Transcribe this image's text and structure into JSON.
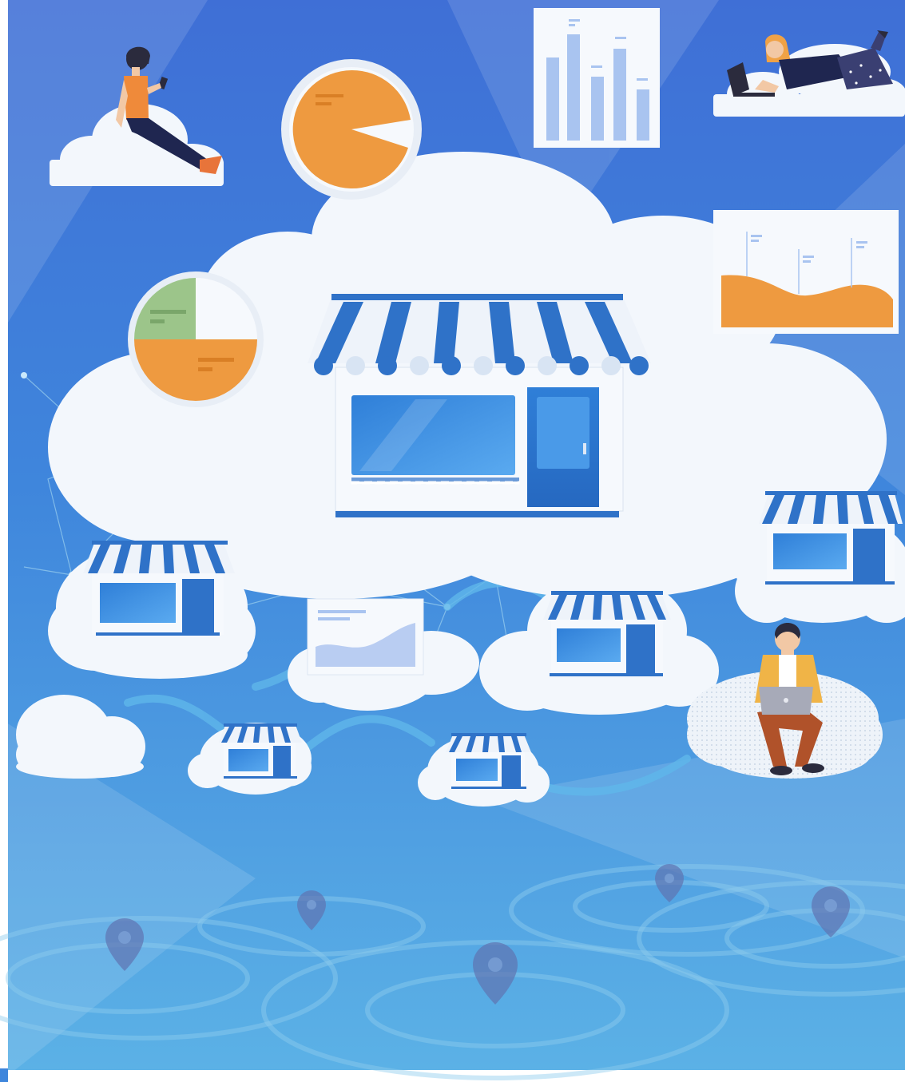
{
  "illustration": {
    "subject": "cloud-commerce-network",
    "palette": {
      "bg_top": "#3f6fd6",
      "bg_mid": "#3f8fdc",
      "bg_bottom": "#5cb2e6",
      "cloud": "#f3f7fc",
      "cloud_shade": "#dce6f2",
      "stripe_blue": "#2f72c8",
      "stripe_white": "#eef3fa",
      "window_blue": "#3b8fe0",
      "chart_orange": "#ee9a40",
      "chart_green": "#9cc58a",
      "chart_bar": "#a9c4f0",
      "network_line": "#9bd0ee"
    },
    "icons": [
      "storefront-icon",
      "cloud-icon",
      "pie-chart-icon",
      "bar-chart-icon",
      "area-chart-icon",
      "location-pin-icon",
      "person-icon",
      "laptop-icon",
      "phone-icon"
    ]
  }
}
